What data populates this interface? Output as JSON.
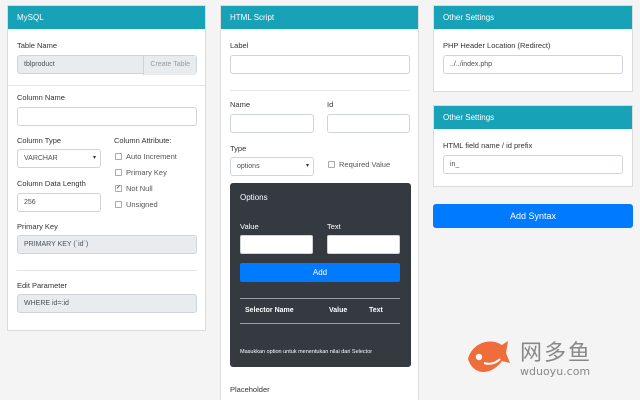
{
  "mysql": {
    "header": "MySQL",
    "table_name_label": "Table Name",
    "table_name_value": "tblproduct",
    "create_table_btn": "Create Table",
    "column_name_label": "Column Name",
    "column_name_value": "",
    "column_type_label": "Column Type",
    "column_type_value": "VARCHAR",
    "column_attribute_label": "Column Attribute:",
    "attributes": [
      {
        "label": "Auto Increment",
        "checked": false
      },
      {
        "label": "Primary Key",
        "checked": false
      },
      {
        "label": "Not Null",
        "checked": true
      },
      {
        "label": "Unsigned",
        "checked": false
      }
    ],
    "column_length_label": "Column Data Length",
    "column_length_value": "256",
    "primary_key_label": "Primary Key",
    "primary_key_value": "PRIMARY KEY (`id`)",
    "edit_param_label": "Edit Parameter",
    "edit_param_value": "WHERE id=:id"
  },
  "html": {
    "header": "HTML Script",
    "label_label": "Label",
    "label_value": "",
    "name_label": "Name",
    "id_label": "Id",
    "type_label": "Type",
    "type_value": "options",
    "required_label": "Required Value",
    "options": {
      "title": "Options",
      "value_label": "Value",
      "text_label": "Text",
      "add_btn": "Add",
      "col_selector": "Selector Name",
      "col_value": "Value",
      "col_text": "Text",
      "note": "Masukkan option untuk menentukan nilai dari Selector"
    },
    "placeholder_label": "Placeholder"
  },
  "settings1": {
    "header": "Other Settings",
    "php_label": "PHP Header Location (Redirect)",
    "php_value": "../../index.php"
  },
  "settings2": {
    "header": "Other Settings",
    "prefix_label": "HTML field name / id prefix",
    "prefix_value": "in_"
  },
  "add_syntax_btn": "Add Syntax",
  "watermark": {
    "cn": "网多鱼",
    "url": "wduoyu.com"
  }
}
